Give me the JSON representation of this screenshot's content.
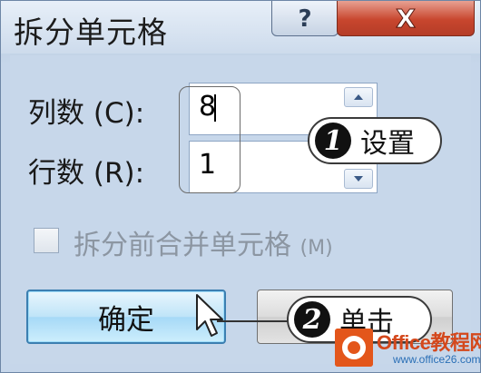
{
  "window": {
    "title": "拆分单元格",
    "help_glyph": "?",
    "close_glyph": "X"
  },
  "fields": {
    "columns": {
      "label": "列数",
      "mnemonic": "(C):",
      "value": "8"
    },
    "rows": {
      "label": "行数",
      "mnemonic": "(R):",
      "value": "1"
    }
  },
  "checkbox": {
    "label": "拆分前合并单元格",
    "mnemonic": "(M)",
    "checked": false,
    "enabled": false
  },
  "buttons": {
    "ok": "确定"
  },
  "annotations": [
    {
      "number": "1",
      "text": "设置"
    },
    {
      "number": "2",
      "text": "单击"
    }
  ],
  "watermark": {
    "brand": "Office教程网",
    "url": "www.office26.com"
  },
  "colors": {
    "dialog_bg": "#c7d7ea",
    "close_red": "#c8462e",
    "ok_blue": "#a6d9f7",
    "watermark_orange": "#e3561b"
  },
  "icons": [
    "help-icon",
    "close-icon",
    "spin-up-icon",
    "spin-down-icon",
    "mouse-cursor-icon",
    "office-logo-icon"
  ]
}
